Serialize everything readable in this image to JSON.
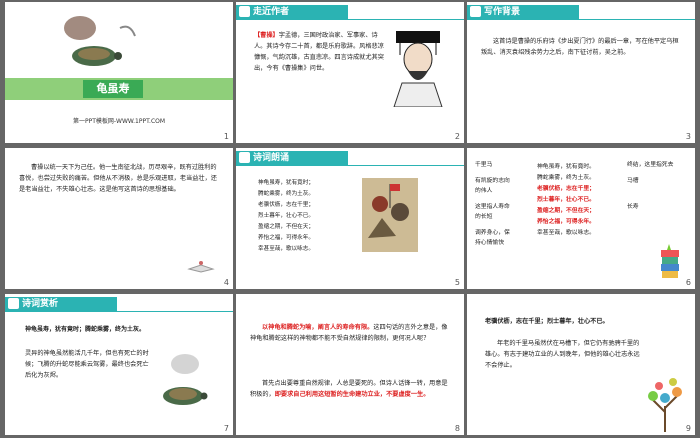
{
  "slides": {
    "s1": {
      "title": "龟虽寿",
      "footer": "第一PPT模板网-WWW.1PPT.COM",
      "num": "1"
    },
    "s2": {
      "header": "走近作者",
      "author_name": "【曹操】",
      "bio": "字孟德，三国时政治家、军事家、诗人。其诗今存二十首，都是乐府歌辞。风格悲凉慷慨，气韵沉雄，古直悲凉。四言诗成就尤其突出，今有《曹操集》问世。",
      "num": "2"
    },
    "s3": {
      "header": "写作背景",
      "text": "这首诗是曹操的乐府诗《步出夏门行》的最后一章，写在他平定乌桓叛乱、消灭袁绍残余势力之后，南下征讨前，吴之前。",
      "num": "3"
    },
    "s4": {
      "text": "曹操以统一天下为己任。他一生南征北战，历尽艰辛，既有过胜利的喜悦，也尝过失败的痛苦。但他从不消极，总是乐观进取，老当益壮，还是老当益壮，不失雄心壮志。这是他写这首诗的思想基础。",
      "num": "4"
    },
    "s5": {
      "header": "诗词朗诵",
      "lines": [
        "神龟虽寿，犹有竟时；",
        "腾蛇乘雾，终为土灰。",
        "老骥伏枥，志在千里；",
        "烈士暮年，壮心不已。",
        "盈缩之期，不但在天；",
        "养怡之福，可得永年。",
        "幸甚至哉，歌以咏志。"
      ],
      "num": "5"
    },
    "s6": {
      "left": [
        "千里马",
        "有凯旋的志向的伟人",
        "这里指人寿命的长短",
        "调养身心，保持心情愉快"
      ],
      "mid": [
        "神龟虽寿，犹有竟时。",
        "腾蛇乘雾，终为土灰。",
        "老骥伏枥，志在千里；",
        "烈士暮年，壮心不已。",
        "盈缩之期，不但在天；",
        "养怡之福，可得永年。",
        "幸甚至哉，歌以咏志。"
      ],
      "right": [
        "终结，这里指死去",
        "马槽",
        "长寿"
      ],
      "num": "6"
    },
    "s7": {
      "header": "诗词赏析",
      "verse": "神龟虽寿，犹有竟时；腾蛇乘雾，终为土灰。",
      "text": "灵异的神龟虽然能活几千年，但也有死亡的时候；飞腾的升蛇尽能乘云驾雾，最终也会死亡后化为灰烬。",
      "num": "7"
    },
    "s8": {
      "highlight": "以神龟和腾蛇为喻，阐言人的寿命有限。",
      "text1": "这四句话的言外之意是，像神龟和腾蛇这样的神物都不能不受自然规律的限制，更何况人呢？",
      "text2": "首先点出要尊重自然规律，人总是要死的。但诗人话锋一转，用意是积极的，",
      "highlight2": "即要求自己利用这短暂的生命建功立业，不要虚度一生。",
      "num": "8"
    },
    "s9": {
      "verse": "老骥伏枥，志在千里；烈士暮年，壮心不已。",
      "text": "年老的千里马虽然伏在马槽下，但它仍有驰骋千里的雄心。有志于建功立业的人到晚年，但他的雄心壮志永远不会停止。",
      "num": "9"
    }
  }
}
